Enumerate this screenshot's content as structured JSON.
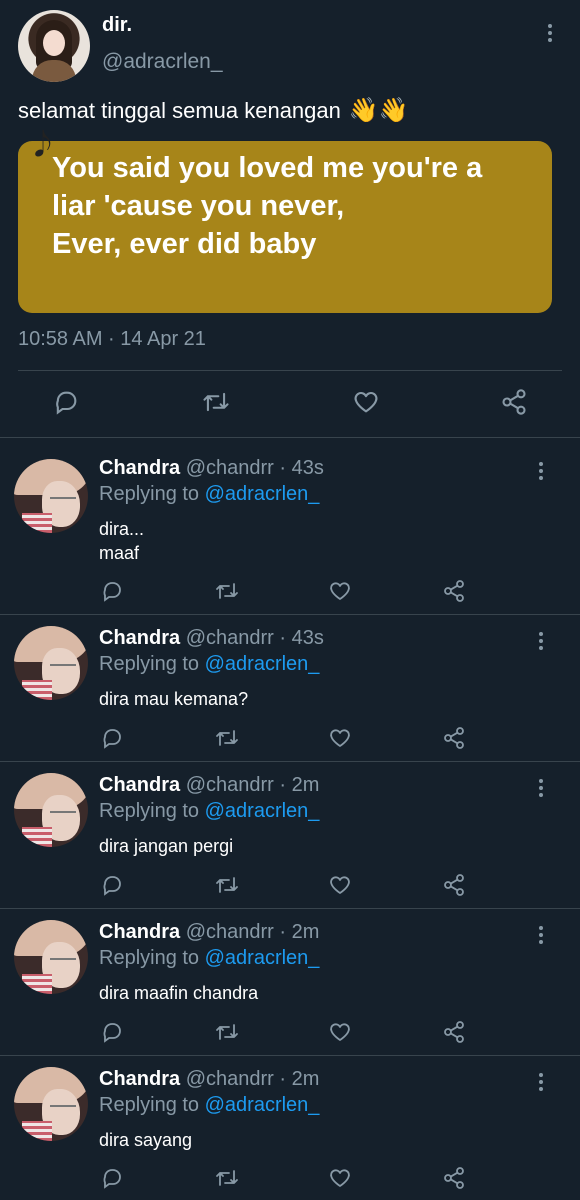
{
  "main_tweet": {
    "display_name": "dir.",
    "handle": "@adracrlen_",
    "text": "selamat tinggal semua kenangan",
    "emoji": "👋👋",
    "lyrics": [
      "You said you loved me you're a",
      "liar 'cause you never,",
      "Ever, ever did baby"
    ],
    "note_icon": "musical-note-icon",
    "timestamp": "10:58 AM · 14 Apr 21"
  },
  "colors": {
    "background": "#15202b",
    "card": "#a78519",
    "muted": "#8899a6",
    "link": "#1d9bf0",
    "divider": "#38444d"
  },
  "replies": [
    {
      "name": "Chandra",
      "meta": "@chandrr · 43s",
      "replying_prefix": "Replying to",
      "replying_handle": "@adracrlen_",
      "lines": [
        "dira...",
        "maaf"
      ]
    },
    {
      "name": "Chandra",
      "meta": "@chandrr · 43s",
      "replying_prefix": "Replying to",
      "replying_handle": "@adracrlen_",
      "lines": [
        "dira mau kemana?"
      ]
    },
    {
      "name": "Chandra",
      "meta": "@chandrr · 2m",
      "replying_prefix": "Replying to",
      "replying_handle": "@adracrlen_",
      "lines": [
        "dira jangan pergi"
      ]
    },
    {
      "name": "Chandra",
      "meta": "@chandrr · 2m",
      "replying_prefix": "Replying to",
      "replying_handle": "@adracrlen_",
      "lines": [
        "dira maafin chandra"
      ]
    },
    {
      "name": "Chandra",
      "meta": "@chandrr · 2m",
      "replying_prefix": "Replying to",
      "replying_handle": "@adracrlen_",
      "lines": [
        "dira sayang"
      ]
    }
  ]
}
